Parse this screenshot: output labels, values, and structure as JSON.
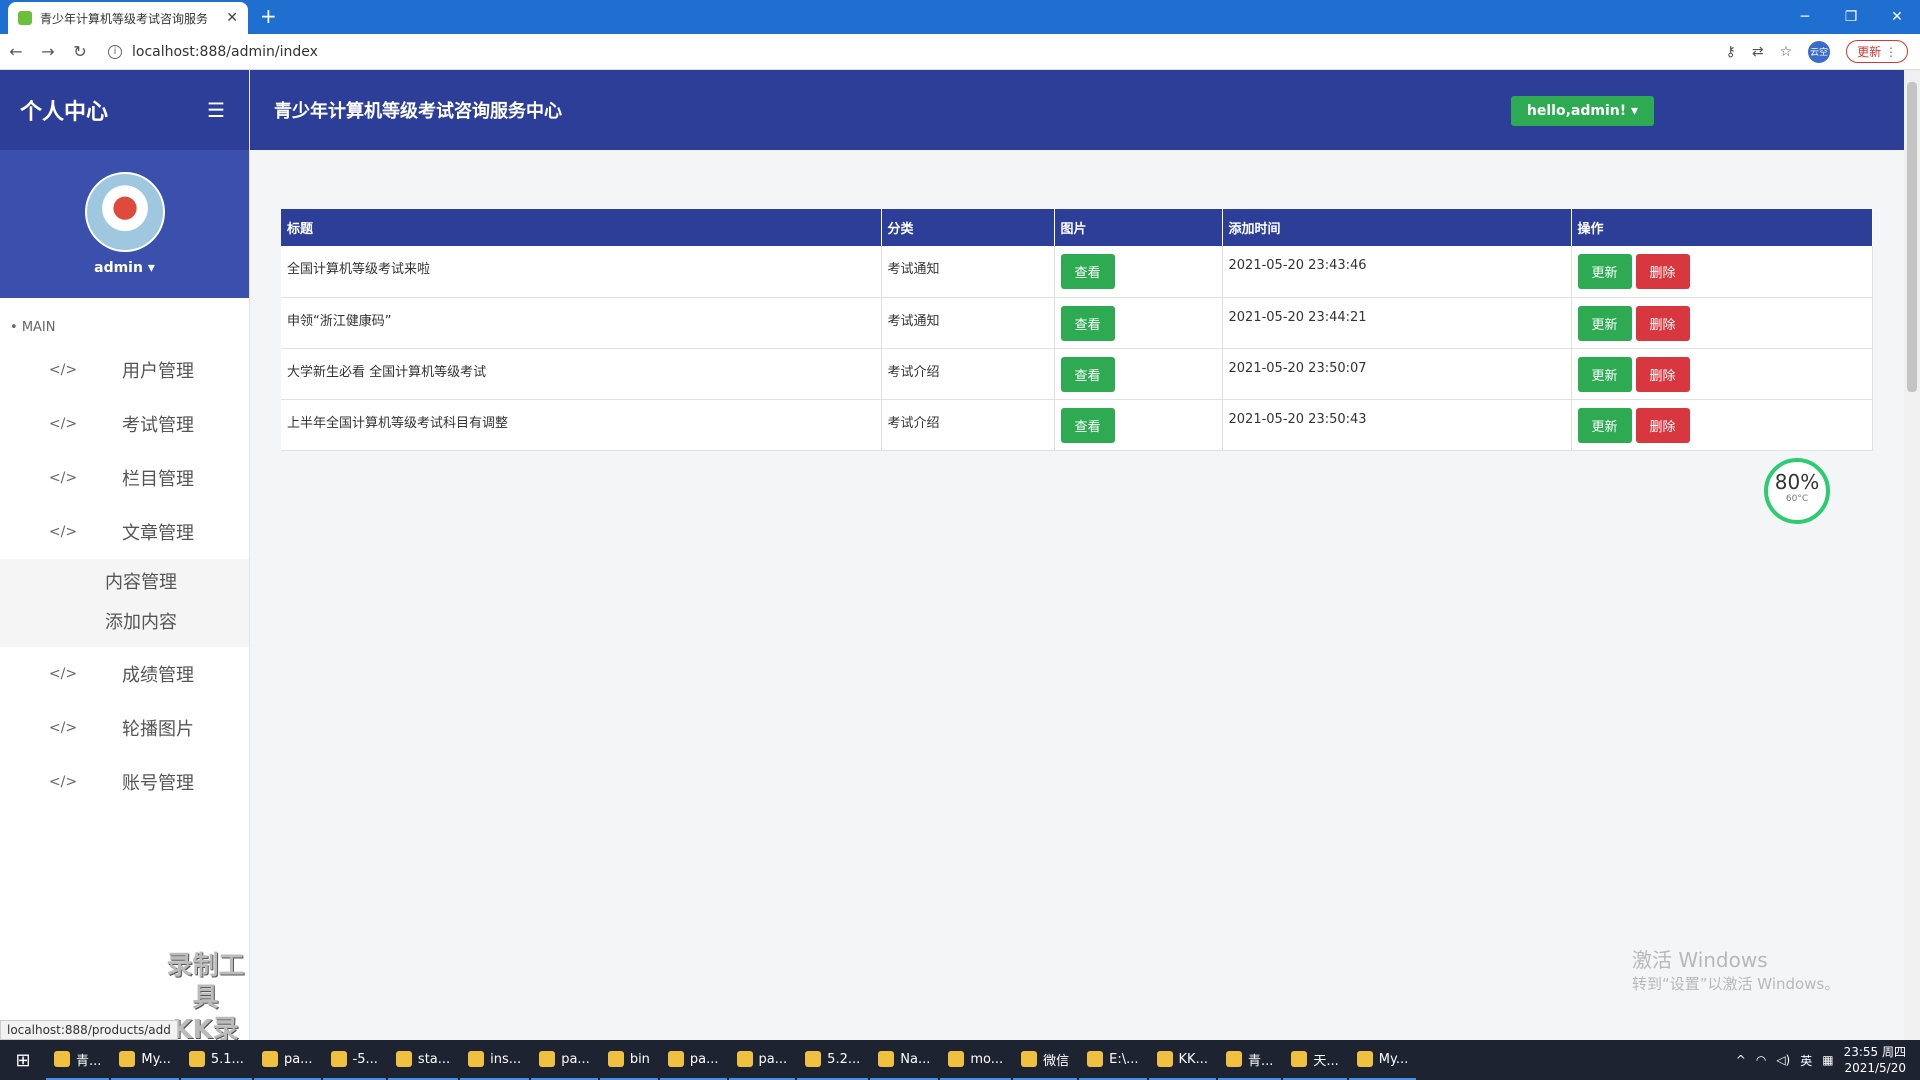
{
  "browser": {
    "tab_title": "青少年计算机等级考试咨询服务",
    "url": "localhost:888/admin/index",
    "update_label": "更新",
    "profile_label": "云空"
  },
  "sidebar": {
    "brand": "个人中心",
    "username": "admin",
    "section_label": "MAIN",
    "items": [
      {
        "label": "用户管理"
      },
      {
        "label": "考试管理"
      },
      {
        "label": "栏目管理"
      },
      {
        "label": "文章管理"
      },
      {
        "label": "成绩管理"
      },
      {
        "label": "轮播图片"
      },
      {
        "label": "账号管理"
      }
    ],
    "subitems": [
      {
        "label": "内容管理"
      },
      {
        "label": "添加内容"
      }
    ],
    "watermark_line1": "录制工具",
    "watermark_line2": "KK录像机"
  },
  "header": {
    "site_title": "青少年计算机等级考试咨询服务中心",
    "user_dropdown": "hello,admin!"
  },
  "table": {
    "columns": [
      "标题",
      "分类",
      "图片",
      "添加时间",
      "操作"
    ],
    "view_label": "查看",
    "update_label": "更新",
    "delete_label": "删除",
    "rows": [
      {
        "title": "全国计算机等级考试来啦",
        "category": "考试通知",
        "time": "2021-05-20 23:43:46"
      },
      {
        "title": "申领“浙江健康码”",
        "category": "考试通知",
        "time": "2021-05-20 23:44:21"
      },
      {
        "title": "大学新生必看 全国计算机等级考试",
        "category": "考试介绍",
        "time": "2021-05-20 23:50:07"
      },
      {
        "title": "上半年全国计算机等级考试科目有调整",
        "category": "考试介绍",
        "time": "2021-05-20 23:50:43"
      }
    ]
  },
  "gauge": {
    "percent": "80%",
    "temp": "60°C"
  },
  "activation": {
    "line1": "激活 Windows",
    "line2": "转到“设置”以激活 Windows。"
  },
  "status_url": "localhost:888/products/add",
  "taskbar": {
    "items": [
      "青...",
      "My...",
      "5.1...",
      "pa...",
      "-5...",
      "sta...",
      "ins...",
      "pa...",
      "bin",
      "pa...",
      "pa...",
      "5.2...",
      "Na...",
      "mo...",
      "微信",
      "E:\\...",
      "KK...",
      "青...",
      "天...",
      "My..."
    ],
    "ime": "英",
    "time": "23:55 周四",
    "date": "2021/5/20"
  }
}
